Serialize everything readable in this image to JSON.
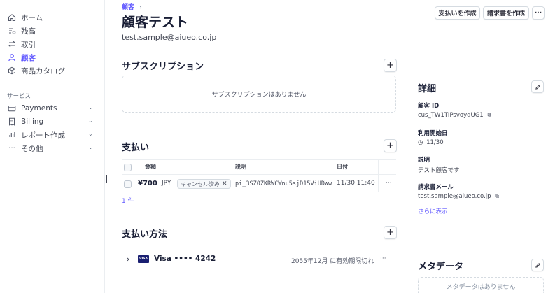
{
  "sidebar": {
    "items": [
      {
        "label": "ホーム",
        "icon": "home-icon"
      },
      {
        "label": "残高",
        "icon": "balance-icon"
      },
      {
        "label": "取引",
        "icon": "transactions-icon"
      },
      {
        "label": "顧客",
        "icon": "customer-icon"
      },
      {
        "label": "商品カタログ",
        "icon": "product-catalog-icon"
      }
    ],
    "section_label": "サービス",
    "services": [
      {
        "label": "Payments",
        "icon": "payments-icon"
      },
      {
        "label": "Billing",
        "icon": "billing-icon"
      },
      {
        "label": "レポート作成",
        "icon": "reports-icon"
      },
      {
        "label": "その他",
        "icon": "more-icon"
      }
    ]
  },
  "header": {
    "breadcrumb": "顧客",
    "breadcrumb_separator": "›",
    "title": "顧客テスト",
    "email": "test.sample@aiueo.co.jp",
    "create_payment_label": "支払いを作成",
    "create_invoice_label": "請求書を作成",
    "more_label": "···"
  },
  "subscriptions": {
    "title": "サブスクリプション",
    "empty_text": "サブスクリプションはありません"
  },
  "payments": {
    "title": "支払い",
    "columns": {
      "amount": "金額",
      "description": "説明",
      "date": "日付"
    },
    "rows": [
      {
        "amount": "¥700",
        "currency": "JPY",
        "status": "キャンセル済み",
        "description": "pi_3SZ0ZKRWCWnu5sjD15ViUDWw",
        "date": "11/30 11:40"
      }
    ],
    "count": "1 件"
  },
  "payment_methods": {
    "title": "支払い方法",
    "card_brand": "VISA",
    "card_label": "Visa •••• 4242",
    "expiry": "2055年12月 に有効期限切れ"
  },
  "details": {
    "title": "詳細",
    "customer_id_label": "顧客 ID",
    "customer_id": "cus_TW1TIPsvoyqUG1",
    "start_label": "利用開始日",
    "start_date": "11/30",
    "description_label": "説明",
    "description": "テスト顧客です",
    "invoice_email_label": "請求書メール",
    "invoice_email": "test.sample@aiueo.co.jp",
    "show_more": "さらに表示"
  },
  "metadata": {
    "title": "メタデータ",
    "empty_text": "メタデータはありません"
  },
  "colors": {
    "accent": "#635bff",
    "text": "#1a1f36",
    "border": "#d5dbe1"
  }
}
